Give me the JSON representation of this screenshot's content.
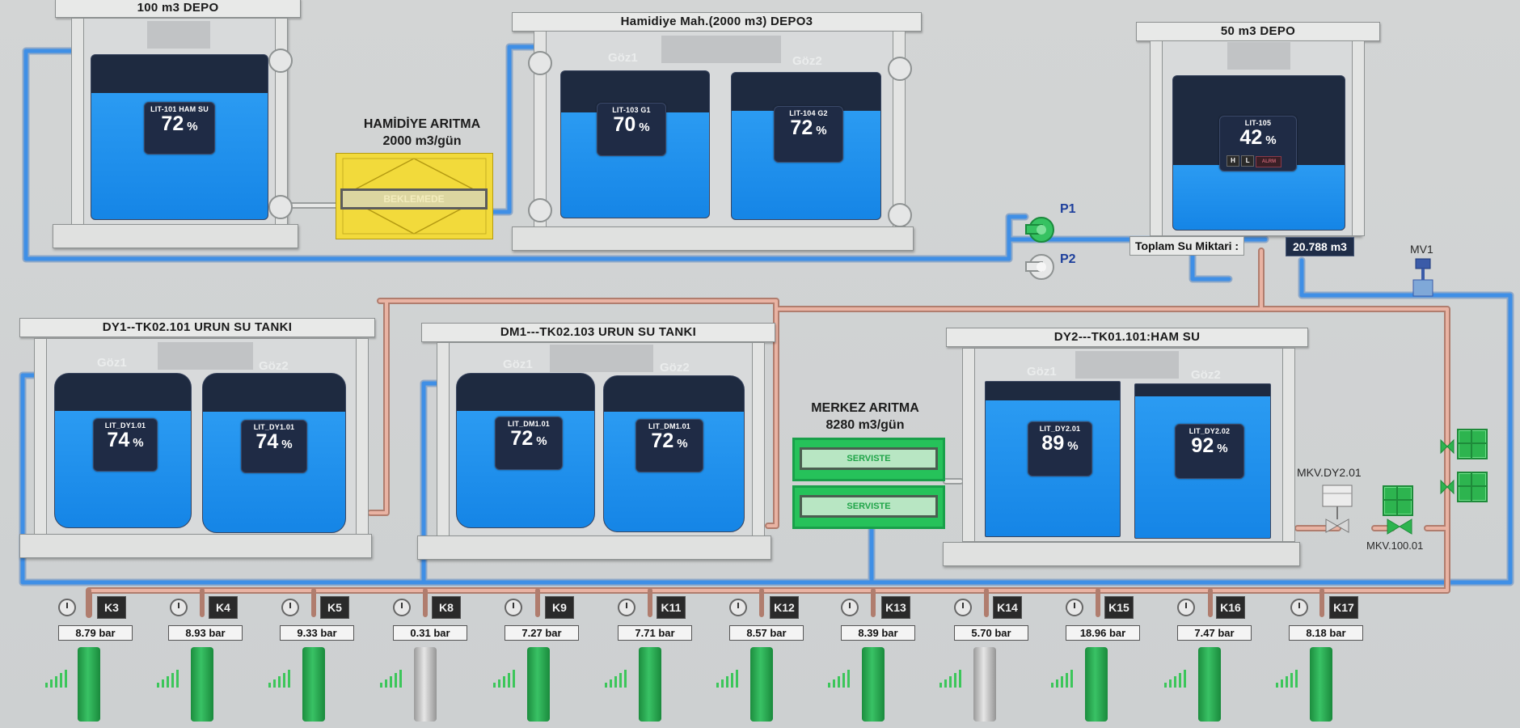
{
  "depo_100": {
    "title": "100 m3 DEPO",
    "tank": {
      "tag": "LIT-101 HAM SU",
      "value": "72",
      "unit": "%",
      "level": 0.72
    }
  },
  "hamidiye_depo": {
    "title": "Hamidiye Mah.(2000 m3) DEPO3",
    "goz1": "Göz1",
    "goz2": "Göz2",
    "tanks": [
      {
        "tag": "LIT-103 G1",
        "value": "70",
        "unit": "%",
        "level": 0.7
      },
      {
        "tag": "LIT-104 G2",
        "value": "72",
        "unit": "%",
        "level": 0.72
      }
    ]
  },
  "depo_50": {
    "title": "50 m3 DEPO",
    "tank": {
      "tag": "LIT-105",
      "value": "42",
      "unit": "%",
      "level": 0.42
    },
    "ind_h": "H",
    "ind_l": "L",
    "ind_alarm": "ALRM"
  },
  "hamidiye_aritma": {
    "name": "HAMİDİYE ARITMA",
    "capacity": "2000 m3/gün",
    "status": "BEKLEMEDE"
  },
  "pumps": {
    "p1": "P1",
    "p2": "P2"
  },
  "total_water": {
    "label": "Toplam Su Miktari :",
    "value": "20.788 m3"
  },
  "valves": {
    "mv1": "MV1",
    "mkv_dy2": "MKV.DY2.01",
    "mkv_100": "MKV.100.01"
  },
  "dy1_tank": {
    "title": "DY1--TK02.101 URUN SU TANKI",
    "goz1": "Göz1",
    "goz2": "Göz2",
    "tanks": [
      {
        "tag": "LIT_DY1.01",
        "value": "74",
        "unit": "%",
        "level": 0.74
      },
      {
        "tag": "LIT_DY1.01",
        "value": "74",
        "unit": "%",
        "level": 0.74
      }
    ]
  },
  "dm1_tank": {
    "title": "DM1---TK02.103 URUN SU TANKI",
    "goz1": "Göz1",
    "goz2": "Göz2",
    "tanks": [
      {
        "tag": "LIT_DM1.01",
        "value": "72",
        "unit": "%",
        "level": 0.72
      },
      {
        "tag": "LIT_DM1.01",
        "value": "72",
        "unit": "%",
        "level": 0.72
      }
    ]
  },
  "merkez_aritma": {
    "name": "MERKEZ ARITMA",
    "capacity": "8280 m3/gün",
    "status1": "SERVISTE",
    "status2": "SERVISTE"
  },
  "dy2_tank": {
    "title": "DY2---TK01.101:HAM SU",
    "goz1": "Göz1",
    "goz2": "Göz2",
    "tanks": [
      {
        "tag": "LIT_DY2.01",
        "value": "89",
        "unit": "%",
        "level": 0.89
      },
      {
        "tag": "LIT_DY2.02",
        "value": "92",
        "unit": "%",
        "level": 0.92
      }
    ]
  },
  "wells": [
    {
      "id": "K3",
      "pressure": "8.79 bar",
      "running": true
    },
    {
      "id": "K4",
      "pressure": "8.93 bar",
      "running": true
    },
    {
      "id": "K5",
      "pressure": "9.33 bar",
      "running": true
    },
    {
      "id": "K8",
      "pressure": "0.31 bar",
      "running": false
    },
    {
      "id": "K9",
      "pressure": "7.27 bar",
      "running": true
    },
    {
      "id": "K11",
      "pressure": "7.71 bar",
      "running": true
    },
    {
      "id": "K12",
      "pressure": "8.57 bar",
      "running": true
    },
    {
      "id": "K13",
      "pressure": "8.39 bar",
      "running": true
    },
    {
      "id": "K14",
      "pressure": "5.70 bar",
      "running": false
    },
    {
      "id": "K15",
      "pressure": "18.96 bar",
      "running": true
    },
    {
      "id": "K16",
      "pressure": "7.47 bar",
      "running": true
    },
    {
      "id": "K17",
      "pressure": "8.18 bar",
      "running": true
    }
  ],
  "colors": {
    "water": "#1a8cec",
    "tank_empty": "#1e2a40",
    "pipe_water": "#3f8fe6",
    "pipe_product": "#d99a86",
    "running": "#2db44f",
    "standby": "#f2da3b"
  }
}
